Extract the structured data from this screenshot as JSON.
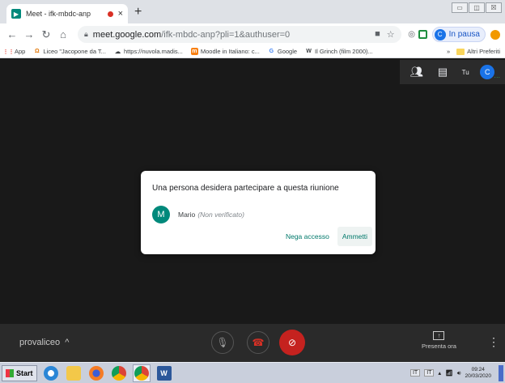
{
  "browser": {
    "tab_title": "Meet - ifk-mbdc-anp",
    "tab_close": "×",
    "new_tab": "+",
    "window_controls": [
      "▭",
      "◫",
      "☒"
    ],
    "url_host": "meet.google.com",
    "url_rest": "/ifk-mbdc-anp?pli=1&authuser=0",
    "profile_initial": "C",
    "profile_status": "In pausa"
  },
  "bookmarks": {
    "items": [
      {
        "label": "App",
        "icon": "apps-grid-icon",
        "color": "#ea4335"
      },
      {
        "label": "Liceo \"Jacopone da T...",
        "icon": "liceo-icon",
        "color": "#e37400"
      },
      {
        "label": "https://nuvola.madis...",
        "icon": "cloud-icon",
        "color": "#202124"
      },
      {
        "label": "Moodle in Italiano: c...",
        "icon": "moodle-icon",
        "color": "#f98012"
      },
      {
        "label": "Google",
        "icon": "google-icon",
        "color": "#4285f4"
      },
      {
        "label": "Il Grinch (film 2000)...",
        "icon": "wikipedia-icon",
        "color": "#202124"
      }
    ],
    "more": "»",
    "other": "Altri Preferiti"
  },
  "stage": {
    "you_label": "Tu",
    "you_initial": "C"
  },
  "dialog": {
    "title": "Una persona desidera partecipare a questa riunione",
    "person_initial": "M",
    "person_name": "Mario",
    "person_status": "(Non verificato)",
    "deny_label": "Nega accesso",
    "admit_label": "Ammetti"
  },
  "controls": {
    "meeting_code": "provaliceo",
    "present_label": "Presenta ora"
  },
  "taskbar": {
    "start_label": "Start",
    "lang1": "IT",
    "lang2": "IT",
    "time": "09:24",
    "date": "20/03/2020"
  },
  "colors": {
    "meet_teal": "#00796b",
    "hangup_red": "#d93025",
    "cam_off_red": "#c5221f"
  }
}
